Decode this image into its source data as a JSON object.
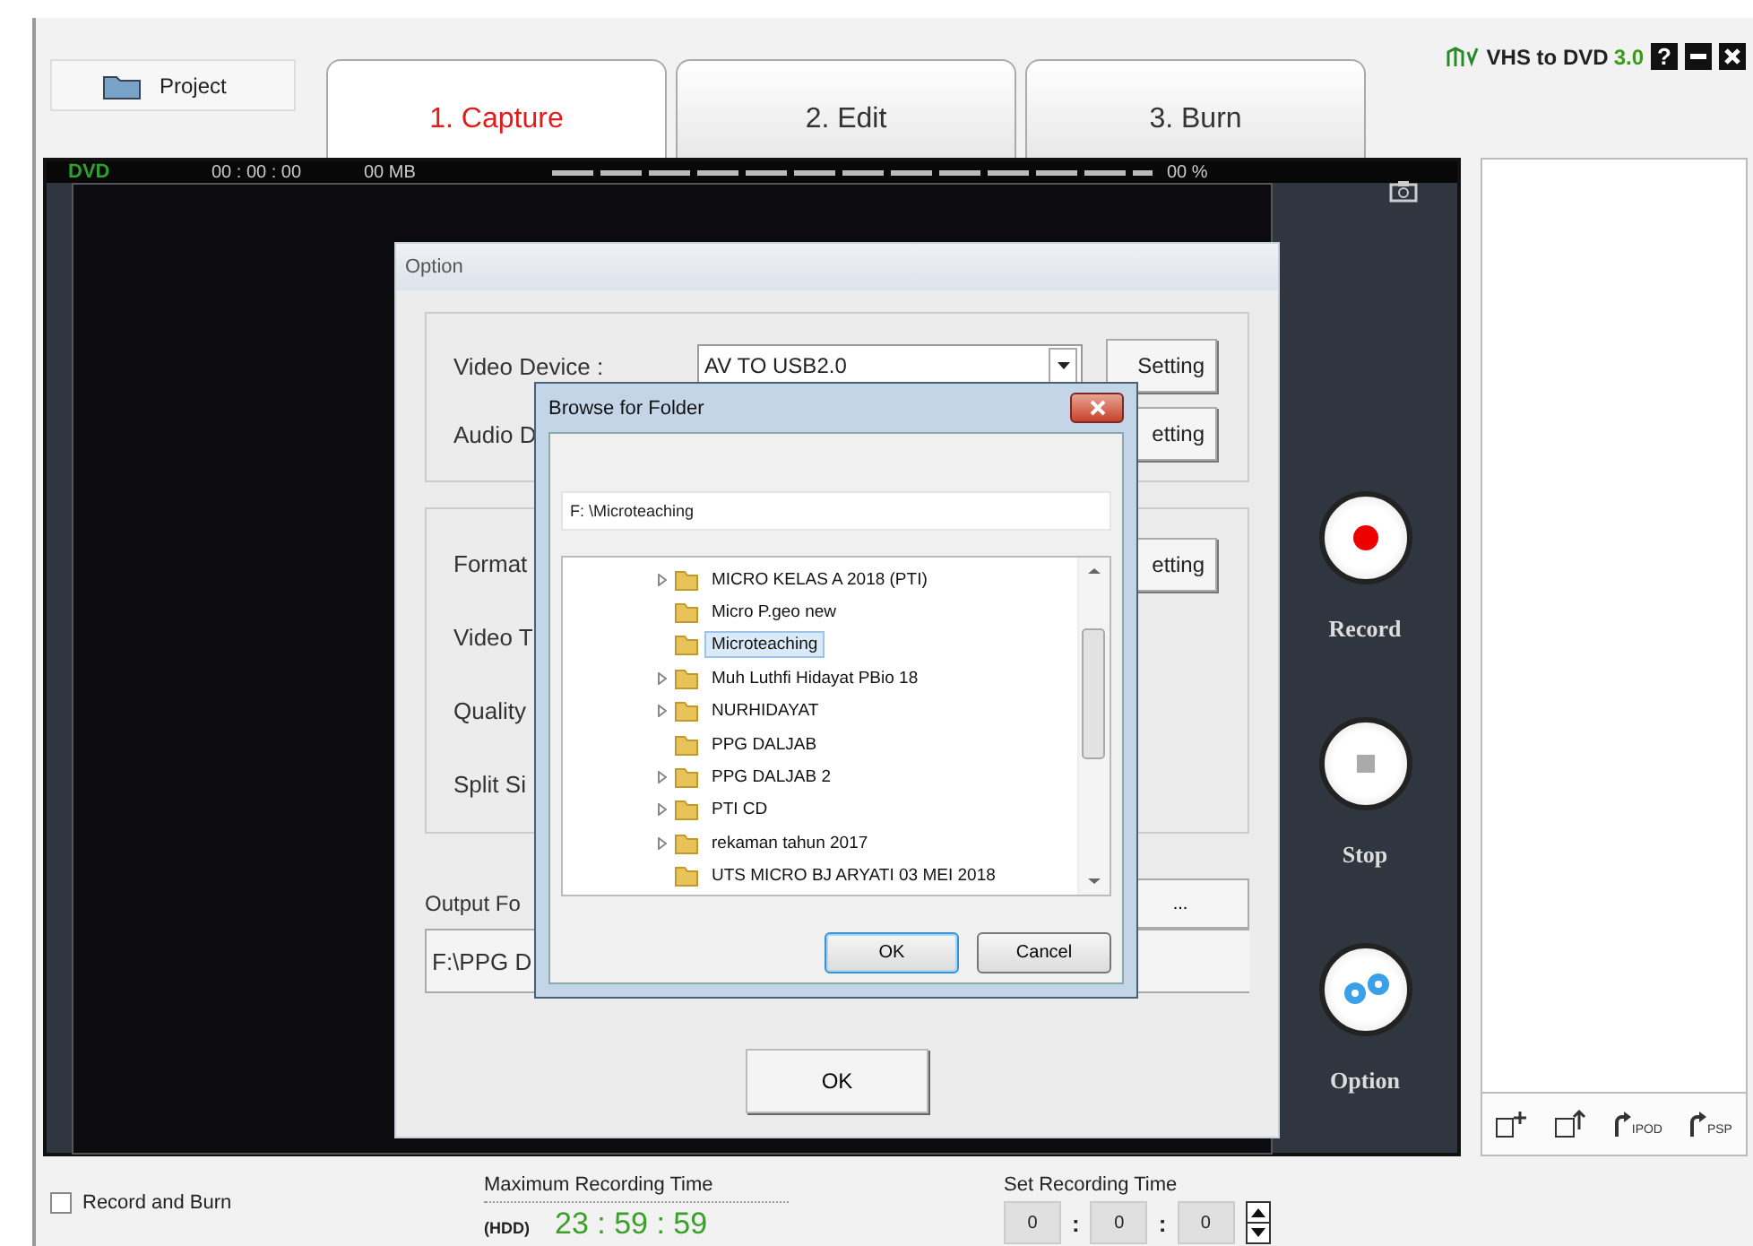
{
  "project_button": "Project",
  "tabs": [
    {
      "label": "1. Capture",
      "selected": true
    },
    {
      "label": "2. Edit",
      "selected": false
    },
    {
      "label": "3. Burn",
      "selected": false
    }
  ],
  "app": {
    "title": "VHS to DVD",
    "version": "3.0",
    "help": "?"
  },
  "status": {
    "disc": "DVD",
    "time": "00 : 00 : 00",
    "size": "00 MB",
    "percent": "00 %"
  },
  "controls": [
    {
      "kind": "record",
      "label": "Record"
    },
    {
      "kind": "stop",
      "label": "Stop"
    },
    {
      "kind": "option",
      "label": "Option"
    }
  ],
  "option_dialog": {
    "title": "Option",
    "device_rows": [
      {
        "label": "Video Device :",
        "value": "AV TO USB2.0",
        "button": "Setting"
      },
      {
        "label": "Audio D",
        "button": "etting"
      }
    ],
    "format_rows": [
      {
        "label": "Format",
        "button": "etting"
      },
      {
        "label": "Video T"
      },
      {
        "label": "Quality"
      },
      {
        "label": "Split Si"
      }
    ],
    "output_label": "Output Fo",
    "browse_button": "...",
    "output_path": "F:\\PPG D",
    "ok": "OK"
  },
  "browse_dialog": {
    "title": "Browse for Folder",
    "path": "F: \\Microteaching",
    "folders": [
      {
        "name": "MICRO KELAS A 2018 (PTI)",
        "expandable": true,
        "selected": false
      },
      {
        "name": "Micro P.geo new",
        "expandable": false,
        "selected": false
      },
      {
        "name": "Microteaching",
        "expandable": false,
        "selected": true
      },
      {
        "name": "Muh Luthfi Hidayat PBio 18",
        "expandable": true,
        "selected": false
      },
      {
        "name": "NURHIDAYAT",
        "expandable": true,
        "selected": false
      },
      {
        "name": "PPG DALJAB",
        "expandable": false,
        "selected": false
      },
      {
        "name": "PPG DALJAB 2",
        "expandable": true,
        "selected": false
      },
      {
        "name": "PTI CD",
        "expandable": true,
        "selected": false
      },
      {
        "name": "rekaman tahun 2017",
        "expandable": true,
        "selected": false
      },
      {
        "name": "UTS MICRO BJ ARYATI 03 MEI 2018",
        "expandable": false,
        "selected": false
      }
    ],
    "ok": "OK",
    "cancel": "Cancel"
  },
  "record_and_burn": {
    "label": "Record and Burn",
    "checked": false
  },
  "max_time": {
    "label": "Maximum Recording Time",
    "unit": "(HDD)",
    "value": "23 : 59 : 59"
  },
  "set_time": {
    "label": "Set Recording Time",
    "fields": [
      "0",
      "0",
      "0"
    ],
    "separator": ":"
  },
  "toolbar": [
    {
      "kind": "add"
    },
    {
      "kind": "export"
    },
    {
      "kind": "convert",
      "label": "IPOD"
    },
    {
      "kind": "convert",
      "label": "PSP"
    }
  ]
}
